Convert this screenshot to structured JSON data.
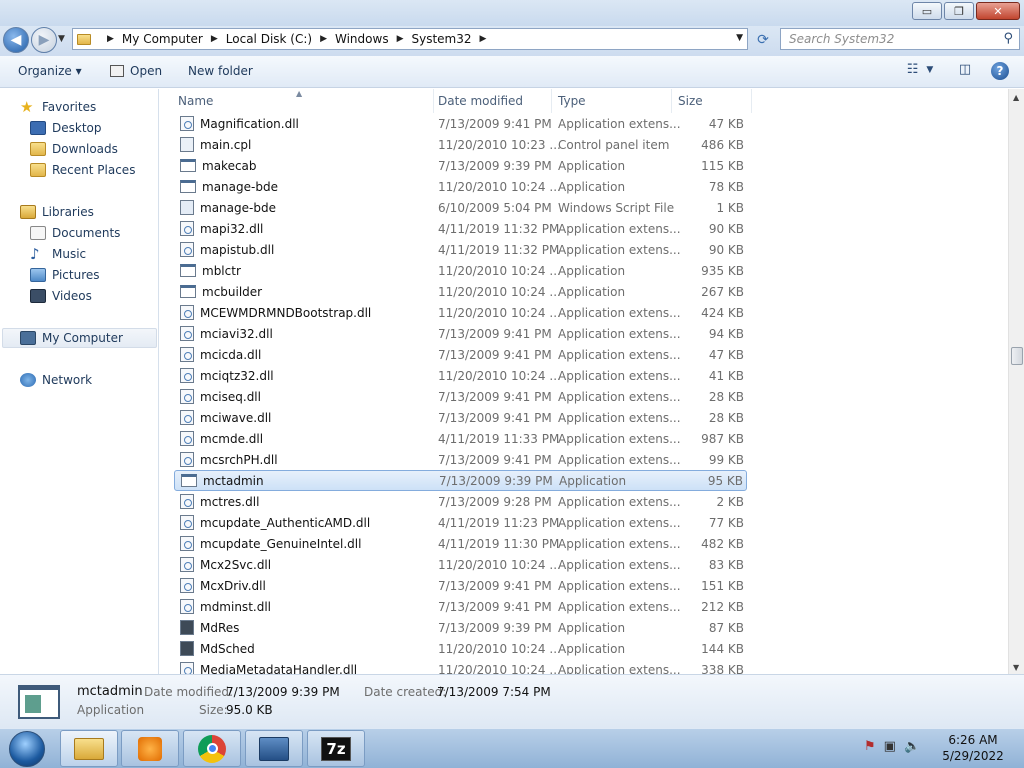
{
  "window": {
    "min_label": "▭",
    "max_label": "❐",
    "close_label": "✕"
  },
  "address": {
    "breadcrumbs": [
      "My Computer",
      "Local Disk (C:)",
      "Windows",
      "System32"
    ],
    "search_placeholder": "Search System32"
  },
  "toolbar": {
    "organize_label": "Organize ▾",
    "open_label": "Open",
    "new_folder_label": "New folder"
  },
  "nav": {
    "favorites": "Favorites",
    "desktop": "Desktop",
    "downloads": "Downloads",
    "recent_places": "Recent Places",
    "libraries": "Libraries",
    "documents": "Documents",
    "music": "Music",
    "pictures": "Pictures",
    "videos": "Videos",
    "my_computer": "My Computer",
    "network": "Network"
  },
  "columns": {
    "name": "Name",
    "date_modified": "Date modified",
    "type": "Type",
    "size": "Size"
  },
  "files": [
    {
      "name": "Magnification.dll",
      "date": "7/13/2009 9:41 PM",
      "type": "Application extens...",
      "size": "47 KB",
      "icon": "dll"
    },
    {
      "name": "main.cpl",
      "date": "11/20/2010 10:23 ...",
      "type": "Control panel item",
      "size": "486 KB",
      "icon": "cpl"
    },
    {
      "name": "makecab",
      "date": "7/13/2009 9:39 PM",
      "type": "Application",
      "size": "115 KB",
      "icon": "app"
    },
    {
      "name": "manage-bde",
      "date": "11/20/2010 10:24 ...",
      "type": "Application",
      "size": "78 KB",
      "icon": "app"
    },
    {
      "name": "manage-bde",
      "date": "6/10/2009 5:04 PM",
      "type": "Windows Script File",
      "size": "1 KB",
      "icon": "script"
    },
    {
      "name": "mapi32.dll",
      "date": "4/11/2019 11:32 PM",
      "type": "Application extens...",
      "size": "90 KB",
      "icon": "dll"
    },
    {
      "name": "mapistub.dll",
      "date": "4/11/2019 11:32 PM",
      "type": "Application extens...",
      "size": "90 KB",
      "icon": "dll"
    },
    {
      "name": "mblctr",
      "date": "11/20/2010 10:24 ...",
      "type": "Application",
      "size": "935 KB",
      "icon": "app"
    },
    {
      "name": "mcbuilder",
      "date": "11/20/2010 10:24 ...",
      "type": "Application",
      "size": "267 KB",
      "icon": "app"
    },
    {
      "name": "MCEWMDRMNDBootstrap.dll",
      "date": "11/20/2010 10:24 ...",
      "type": "Application extens...",
      "size": "424 KB",
      "icon": "dll"
    },
    {
      "name": "mciavi32.dll",
      "date": "7/13/2009 9:41 PM",
      "type": "Application extens...",
      "size": "94 KB",
      "icon": "dll"
    },
    {
      "name": "mcicda.dll",
      "date": "7/13/2009 9:41 PM",
      "type": "Application extens...",
      "size": "47 KB",
      "icon": "dll"
    },
    {
      "name": "mciqtz32.dll",
      "date": "11/20/2010 10:24 ...",
      "type": "Application extens...",
      "size": "41 KB",
      "icon": "dll"
    },
    {
      "name": "mciseq.dll",
      "date": "7/13/2009 9:41 PM",
      "type": "Application extens...",
      "size": "28 KB",
      "icon": "dll"
    },
    {
      "name": "mciwave.dll",
      "date": "7/13/2009 9:41 PM",
      "type": "Application extens...",
      "size": "28 KB",
      "icon": "dll"
    },
    {
      "name": "mcmde.dll",
      "date": "4/11/2019 11:33 PM",
      "type": "Application extens...",
      "size": "987 KB",
      "icon": "dll"
    },
    {
      "name": "mcsrchPH.dll",
      "date": "7/13/2009 9:41 PM",
      "type": "Application extens...",
      "size": "99 KB",
      "icon": "dll"
    },
    {
      "name": "mctadmin",
      "date": "7/13/2009 9:39 PM",
      "type": "Application",
      "size": "95 KB",
      "icon": "app",
      "selected": true
    },
    {
      "name": "mctres.dll",
      "date": "7/13/2009 9:28 PM",
      "type": "Application extens...",
      "size": "2 KB",
      "icon": "dll"
    },
    {
      "name": "mcupdate_AuthenticAMD.dll",
      "date": "4/11/2019 11:23 PM",
      "type": "Application extens...",
      "size": "77 KB",
      "icon": "dll"
    },
    {
      "name": "mcupdate_GenuineIntel.dll",
      "date": "4/11/2019 11:30 PM",
      "type": "Application extens...",
      "size": "482 KB",
      "icon": "dll"
    },
    {
      "name": "Mcx2Svc.dll",
      "date": "11/20/2010 10:24 ...",
      "type": "Application extens...",
      "size": "83 KB",
      "icon": "dll"
    },
    {
      "name": "McxDriv.dll",
      "date": "7/13/2009 9:41 PM",
      "type": "Application extens...",
      "size": "151 KB",
      "icon": "dll"
    },
    {
      "name": "mdminst.dll",
      "date": "7/13/2009 9:41 PM",
      "type": "Application extens...",
      "size": "212 KB",
      "icon": "dll"
    },
    {
      "name": "MdRes",
      "date": "7/13/2009 9:39 PM",
      "type": "Application",
      "size": "87 KB",
      "icon": "mdres"
    },
    {
      "name": "MdSched",
      "date": "11/20/2010 10:24 ...",
      "type": "Application",
      "size": "144 KB",
      "icon": "mdres"
    },
    {
      "name": "MediaMetadataHandler.dll",
      "date": "11/20/2010 10:24 ...",
      "type": "Application extens...",
      "size": "338 KB",
      "icon": "dll"
    }
  ],
  "details": {
    "name": "mctadmin",
    "type": "Application",
    "date_modified_label": "Date modified:",
    "date_modified": "7/13/2009 9:39 PM",
    "size_label": "Size:",
    "size": "95.0 KB",
    "date_created_label": "Date created:",
    "date_created": "7/13/2009 7:54 PM"
  },
  "taskbar": {
    "time": "6:26 AM",
    "date": "5/29/2022",
    "apps": [
      "windows-explorer",
      "media-player",
      "chrome",
      "control-panel",
      "7-zip"
    ],
    "sevenzip_label": "7z"
  },
  "colors": {
    "selection_border": "#84acdd",
    "selection_fill": "#cde1f7",
    "nav_text": "#1e395b",
    "meta_text": "#6d6d6d"
  }
}
